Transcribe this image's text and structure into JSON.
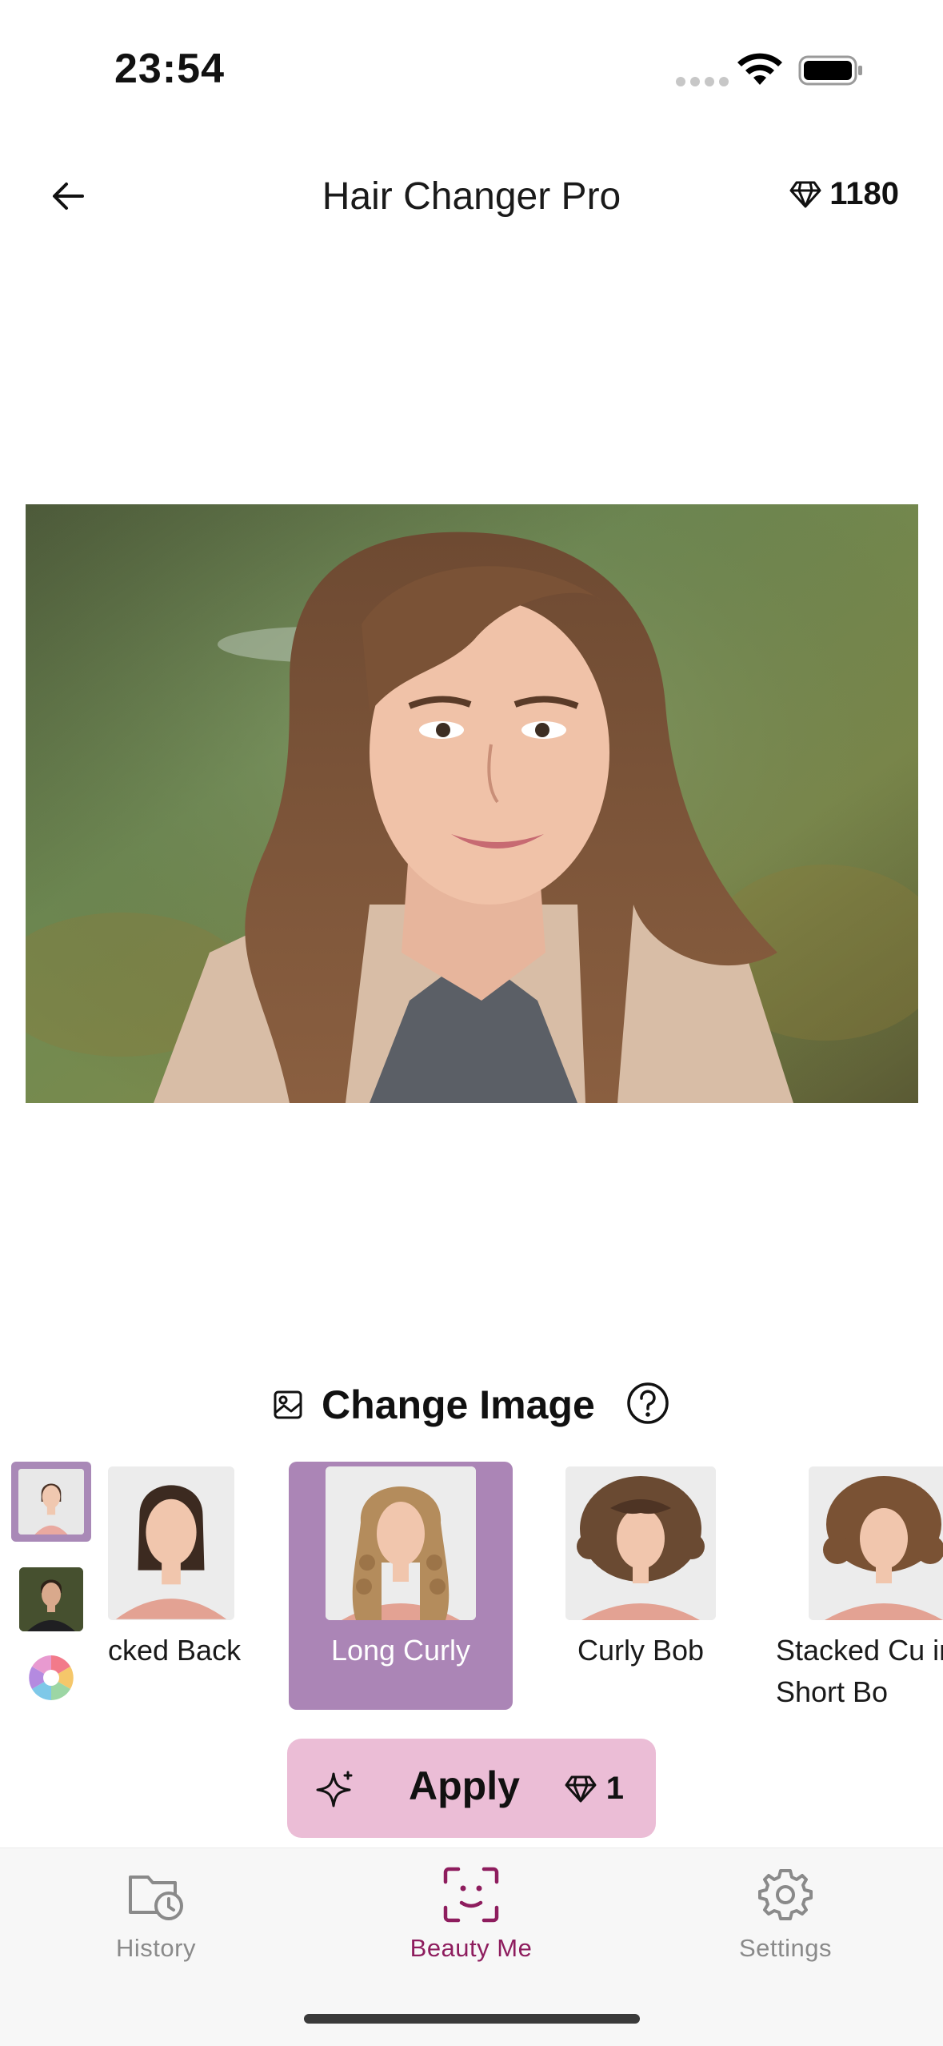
{
  "status_bar": {
    "time": "23:54"
  },
  "header": {
    "title": "Hair Changer Pro",
    "credits": "1180"
  },
  "change_image": {
    "label": "Change Image"
  },
  "styles": [
    {
      "label": "cked Back"
    },
    {
      "label": "Long Curly",
      "selected": true
    },
    {
      "label": "Curly Bob"
    },
    {
      "label": "Stacked Cu in Short Bo"
    }
  ],
  "apply": {
    "label": "Apply",
    "cost": "1"
  },
  "nav": {
    "history": "History",
    "beauty_me": "Beauty Me",
    "settings": "Settings"
  },
  "colors": {
    "accent": "#8e1d5e",
    "selected_bg": "#ab85b6",
    "apply_bg": "#ebbdd6"
  }
}
